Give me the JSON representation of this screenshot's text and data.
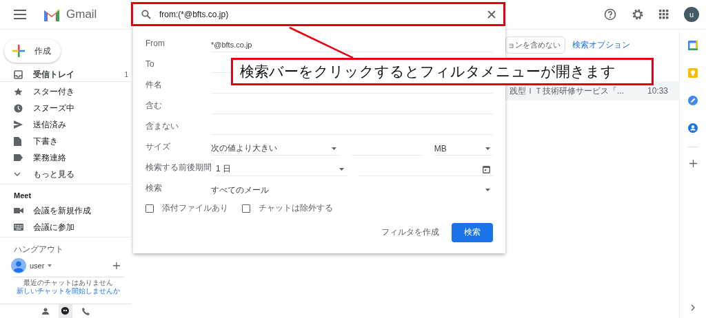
{
  "header": {
    "app_name": "Gmail",
    "avatar_letter": "u"
  },
  "search": {
    "value": "from:(*@bfts.co.jp)"
  },
  "compose": {
    "label": "作成"
  },
  "nav": [
    {
      "kind": "inbox",
      "label": "受信トレイ",
      "count": "1",
      "selected": true
    },
    {
      "kind": "star",
      "label": "スター付き",
      "selected": false
    },
    {
      "kind": "snooze",
      "label": "スヌーズ中",
      "selected": false
    },
    {
      "kind": "sent",
      "label": "送信済み",
      "selected": false
    },
    {
      "kind": "draft",
      "label": "下書き",
      "selected": false
    },
    {
      "kind": "label",
      "label": "業務連絡",
      "selected": false
    },
    {
      "kind": "more",
      "label": "もっと見る",
      "selected": false
    }
  ],
  "meet": {
    "title": "Meet",
    "items": [
      {
        "kind": "video",
        "label": "会議を新規作成"
      },
      {
        "kind": "keyboard",
        "label": "会議に参加"
      }
    ]
  },
  "hangouts": {
    "title": "ハングアウト",
    "user": "user",
    "message": "最近のチャットはありません",
    "link": "新しいチャットを開始しませんか"
  },
  "filter": {
    "rows": [
      {
        "kind": "text",
        "label": "From",
        "value": "*@bfts.co.jp"
      },
      {
        "kind": "text",
        "label": "To"
      },
      {
        "kind": "text",
        "label": "件名"
      },
      {
        "kind": "text",
        "label": "含む"
      },
      {
        "kind": "text",
        "label": "含まない"
      },
      {
        "kind": "size",
        "label": "サイズ",
        "value": "次の値より大きい",
        "unit": "MB"
      },
      {
        "kind": "date",
        "label": "検索する前後期間",
        "value": "1 日"
      },
      {
        "kind": "select",
        "label": "検索",
        "value": "すべてのメール"
      }
    ],
    "checkboxes": [
      {
        "label": "添付ファイルあり",
        "checked": false
      },
      {
        "label": "チャットは除外する",
        "checked": false
      }
    ],
    "create_filter": "フィルタを作成",
    "search_button": "検索"
  },
  "mail": {
    "chip": "ョンを含めない",
    "options_link": "検索オプション",
    "rows": [
      {
        "snippet": "践型ＩＴ技術研修サービス「...",
        "time": "10:33"
      }
    ]
  },
  "annotation": {
    "text": "検索バーをクリックするとフィルタメニューが開きます"
  }
}
